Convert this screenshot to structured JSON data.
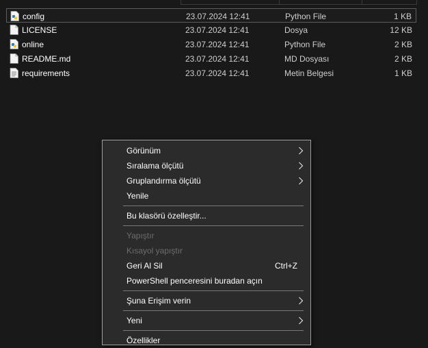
{
  "files": [
    {
      "name": "config",
      "date": "23.07.2024 12:41",
      "type": "Python File",
      "size": "1 KB",
      "icon": "python-file-icon",
      "selected": true
    },
    {
      "name": "LICENSE",
      "date": "23.07.2024 12:41",
      "type": "Dosya",
      "size": "12 KB",
      "icon": "blank-file-icon",
      "selected": false
    },
    {
      "name": "online",
      "date": "23.07.2024 12:41",
      "type": "Python File",
      "size": "2 KB",
      "icon": "python-file-icon",
      "selected": false
    },
    {
      "name": "README.md",
      "date": "23.07.2024 12:41",
      "type": "MD Dosyası",
      "size": "2 KB",
      "icon": "blank-file-icon",
      "selected": false
    },
    {
      "name": "requirements",
      "date": "23.07.2024 12:41",
      "type": "Metin Belgesi",
      "size": "1 KB",
      "icon": "text-file-icon",
      "selected": false
    }
  ],
  "context_menu": {
    "items": [
      {
        "label": "Görünüm",
        "submenu": true,
        "disabled": false
      },
      {
        "label": "Sıralama ölçütü",
        "submenu": true,
        "disabled": false
      },
      {
        "label": "Gruplandırma ölçütü",
        "submenu": true,
        "disabled": false
      },
      {
        "label": "Yenile",
        "submenu": false,
        "disabled": false
      },
      {
        "label": "Bu klasörü özelleştir...",
        "submenu": false,
        "disabled": false
      },
      {
        "label": "Yapıştır",
        "submenu": false,
        "disabled": true
      },
      {
        "label": "Kısayol yapıştır",
        "submenu": false,
        "disabled": true
      },
      {
        "label": "Geri Al Sil",
        "submenu": false,
        "disabled": false,
        "shortcut": "Ctrl+Z"
      },
      {
        "label": "PowerShell penceresini buradan açın",
        "submenu": false,
        "disabled": false
      },
      {
        "label": "Şuna Erişim verin",
        "submenu": true,
        "disabled": false
      },
      {
        "label": "Yeni",
        "submenu": true,
        "disabled": false
      },
      {
        "label": "Özellikler",
        "submenu": false,
        "disabled": false
      }
    ]
  },
  "colors": {
    "background": "#191919",
    "menu_background": "#2b2b2b",
    "menu_border": "#a0a0a0",
    "disabled_text": "#6d6d6d",
    "selection_border": "#5d5d5d"
  }
}
